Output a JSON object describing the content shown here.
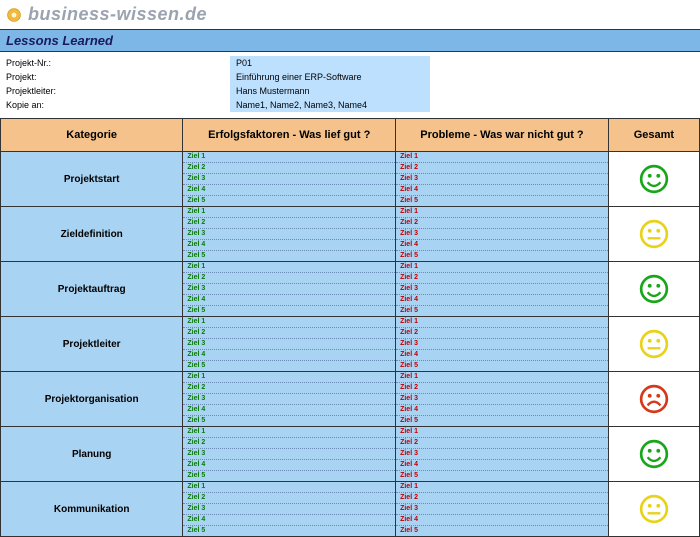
{
  "site": "business-wissen.de",
  "title": "Lessons Learned",
  "meta": {
    "projekt_nr_label": "Projekt-Nr.:",
    "projekt_nr": "P01",
    "projekt_label": "Projekt:",
    "projekt": "Einführung einer ERP-Software",
    "leiter_label": "Projektleiter:",
    "leiter": "Hans Mustermann",
    "kopie_label": "Kopie an:",
    "kopie": "Name1, Name2, Name3, Name4"
  },
  "headers": {
    "kategorie": "Kategorie",
    "erfolg": "Erfolgsfaktoren - Was lief gut ?",
    "probleme": "Probleme - Was war nicht gut ?",
    "gesamt": "Gesamt"
  },
  "ziele": [
    "Ziel 1",
    "Ziel 2",
    "Ziel 3",
    "Ziel 4",
    "Ziel 5"
  ],
  "rows": [
    {
      "kategorie": "Projektstart",
      "status": "green-happy"
    },
    {
      "kategorie": "Zieldefinition",
      "status": "yellow-neutral"
    },
    {
      "kategorie": "Projektauftrag",
      "status": "green-happy"
    },
    {
      "kategorie": "Projektleiter",
      "status": "yellow-neutral"
    },
    {
      "kategorie": "Projektorganisation",
      "status": "red-sad"
    },
    {
      "kategorie": "Planung",
      "status": "green-happy"
    },
    {
      "kategorie": "Kommunikation",
      "status": "yellow-neutral"
    }
  ],
  "colors": {
    "green-happy": "#1aa61a",
    "yellow-neutral": "#e8d21a",
    "red-sad": "#d43a1a"
  }
}
